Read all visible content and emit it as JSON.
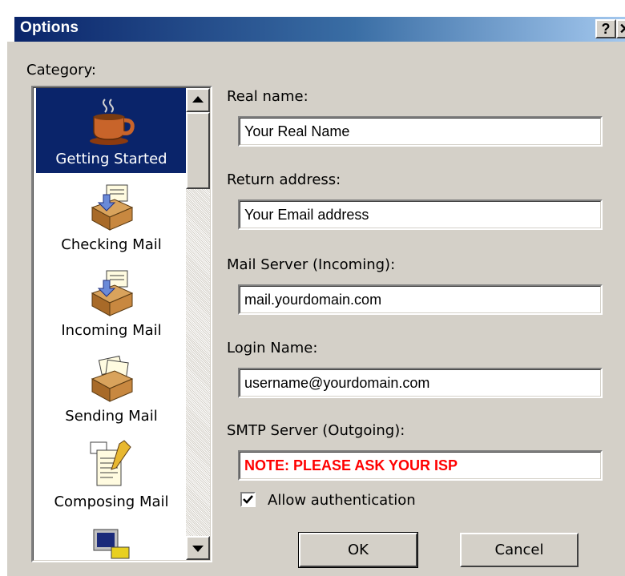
{
  "window": {
    "title": "Options",
    "help_label": "?",
    "close_label": "✕"
  },
  "category": {
    "label": "Category:",
    "items": [
      {
        "label": "Getting Started",
        "icon": "coffee-cup-icon",
        "selected": true
      },
      {
        "label": "Checking Mail",
        "icon": "mail-inbox-icon",
        "selected": false
      },
      {
        "label": "Incoming Mail",
        "icon": "mail-inbox-icon",
        "selected": false
      },
      {
        "label": "Sending Mail",
        "icon": "mail-outbox-icon",
        "selected": false
      },
      {
        "label": "Composing Mail",
        "icon": "notepad-pencil-icon",
        "selected": false
      },
      {
        "label": "",
        "icon": "computer-icon",
        "selected": false
      }
    ]
  },
  "form": {
    "real_name": {
      "label": "Real name:",
      "value": "Your Real Name"
    },
    "return_address": {
      "label": "Return address:",
      "value": "Your Email address"
    },
    "mail_server": {
      "label": "Mail Server (Incoming):",
      "value": "mail.yourdomain.com"
    },
    "login_name": {
      "label": "Login Name:",
      "value": "username@yourdomain.com"
    },
    "smtp_server": {
      "label": "SMTP Server (Outgoing):",
      "value": "NOTE: PLEASE ASK YOUR ISP"
    },
    "allow_auth": {
      "label": "Allow authentication",
      "checked": true
    }
  },
  "buttons": {
    "ok_label": "OK",
    "cancel_label": "Cancel"
  },
  "colors": {
    "title_bar": "#0a246a",
    "selection": "#0a246a",
    "note_text": "#ff0000",
    "dialog_face": "#d4d0c8"
  }
}
